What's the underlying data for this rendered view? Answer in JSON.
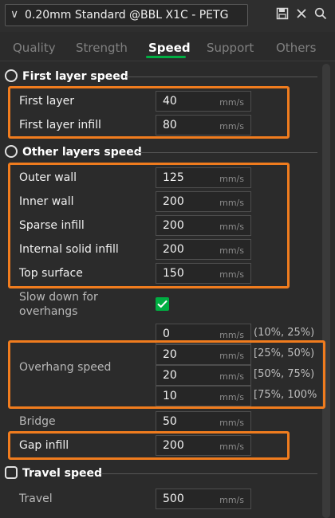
{
  "header": {
    "preset_name": "0.20mm Standard @BBL X1C - PETG",
    "icons": [
      "chevron-down-icon",
      "save-icon",
      "close-icon",
      "search-icon"
    ]
  },
  "tabs": [
    {
      "label": "Quality",
      "active": false
    },
    {
      "label": "Strength",
      "active": false
    },
    {
      "label": "Speed",
      "active": true
    },
    {
      "label": "Support",
      "active": false
    },
    {
      "label": "Others",
      "active": false
    }
  ],
  "sections": {
    "first_layer": {
      "title": "First layer speed",
      "icon": "speedometer-icon"
    },
    "other_layers": {
      "title": "Other layers speed",
      "icon": "speedometer-icon"
    },
    "travel": {
      "title": "Travel speed",
      "icon": "travel-icon"
    }
  },
  "unit": "mm/s",
  "fields": {
    "first_layer": {
      "label": "First layer",
      "value": "40"
    },
    "first_layer_infill": {
      "label": "First layer infill",
      "value": "80"
    },
    "outer_wall": {
      "label": "Outer wall",
      "value": "125"
    },
    "inner_wall": {
      "label": "Inner wall",
      "value": "200"
    },
    "sparse_infill": {
      "label": "Sparse infill",
      "value": "200"
    },
    "internal_solid_infill": {
      "label": "Internal solid infill",
      "value": "200"
    },
    "top_surface": {
      "label": "Top surface",
      "value": "150"
    },
    "slow_down": {
      "label_line1": "Slow down for",
      "label_line2": "overhangs",
      "checked": true
    },
    "overhang": {
      "label": "Overhang speed",
      "rows": [
        {
          "value": "0",
          "range": "(10%, 25%)"
        },
        {
          "value": "20",
          "range": "[25%, 50%)"
        },
        {
          "value": "20",
          "range": "[50%, 75%)"
        },
        {
          "value": "10",
          "range": "[75%, 100%"
        }
      ]
    },
    "bridge": {
      "label": "Bridge",
      "value": "50"
    },
    "gap_infill": {
      "label": "Gap infill",
      "value": "200"
    },
    "travel": {
      "label": "Travel",
      "value": "500"
    }
  },
  "colors": {
    "accent": "#00ae42",
    "highlight": "#f07c1e",
    "background": "#2b2b2b"
  }
}
